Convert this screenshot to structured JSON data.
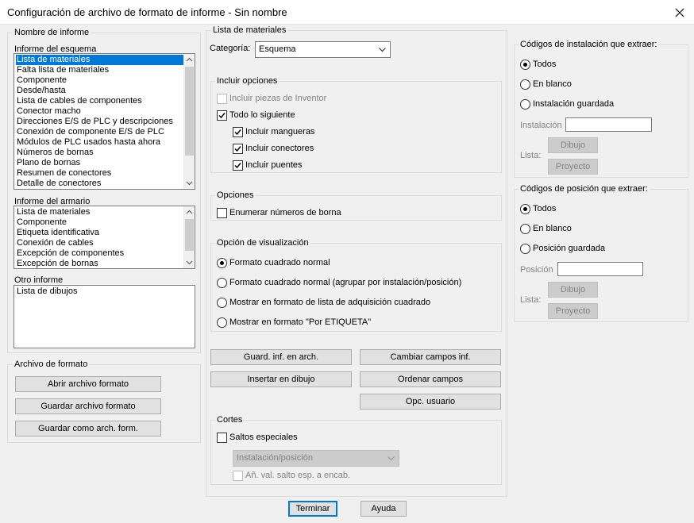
{
  "window": {
    "title": "Configuración de archivo de formato de informe - Sin nombre"
  },
  "report_name": {
    "legend": "Nombre de informe",
    "schematic": {
      "label": "Informe del esquema",
      "items": [
        "Lista de materiales",
        "Falta lista de materiales",
        "Componente",
        "Desde/hasta",
        "Lista de cables de componentes",
        "Conector macho",
        "Direcciones E/S de PLC y descripciones",
        "Conexión de componente E/S de PLC",
        "Módulos de PLC usados hasta ahora",
        "Números de bornas",
        "Plano de bornas",
        "Resumen de conectores",
        "Detalle de conectores"
      ],
      "selected": "Lista de materiales"
    },
    "panel": {
      "label": "Informe del armario",
      "items": [
        "Lista de materiales",
        "Componente",
        "Etiqueta identificativa",
        "Conexión de cables",
        "Excepción de componentes",
        "Excepción de bornas"
      ]
    },
    "other": {
      "label": "Otro informe",
      "items": [
        "Lista de dibujos"
      ]
    }
  },
  "format_file": {
    "legend": "Archivo de formato",
    "open_label": "Abrir archivo formato",
    "save_label": "Guardar archivo formato",
    "save_as_label": "Guardar como arch. form."
  },
  "bom": {
    "legend": "Lista de materiales",
    "category_label": "Categoría:",
    "category_value": "Esquema",
    "include_options": {
      "legend": "Incluir opciones",
      "inventor_parts": "Incluir piezas de Inventor",
      "all_following": "Todo lo siguiente",
      "hoses": "Incluir mangueras",
      "connectors": "Incluir conectores",
      "jumpers": "Incluir puentes"
    },
    "options": {
      "legend": "Opciones",
      "enumerate": "Enumerar números de borna"
    },
    "display": {
      "legend": "Opción de visualización",
      "opt1": "Formato cuadrado normal",
      "opt2": "Formato cuadrado normal (agrupar por instalación/posición)",
      "opt3": "Mostrar en formato de lista de adquisición cuadrado",
      "opt4": "Mostrar en formato \"Por ETIQUETA\""
    },
    "buttons": {
      "save_to_file": "Guard. inf. en arch.",
      "change_fields": "Cambiar campos inf.",
      "insert_drawing": "Insertar en dibujo",
      "sort_fields": "Ordenar campos",
      "user_options": "Opc. usuario"
    },
    "breaks": {
      "legend": "Cortes",
      "special": "Saltos especiales",
      "combo_value": "Instalación/posición",
      "add_value": "Añ. val. salto esp. a encab."
    }
  },
  "installation_codes": {
    "legend": "Códigos de instalación que extraer:",
    "all": "Todos",
    "blank": "En blanco",
    "saved": "Instalación guardada",
    "field_label": "Instalación",
    "list_label": "Lista:",
    "drawing_btn": "Dibujo",
    "project_btn": "Proyecto"
  },
  "location_codes": {
    "legend": "Códigos de posición que extraer:",
    "all": "Todos",
    "blank": "En blanco",
    "saved": "Posición guardada",
    "field_label": "Posición",
    "list_label": "Lista:",
    "drawing_btn": "Dibujo",
    "project_btn": "Proyecto"
  },
  "footer": {
    "done": "Terminar",
    "help": "Ayuda"
  }
}
